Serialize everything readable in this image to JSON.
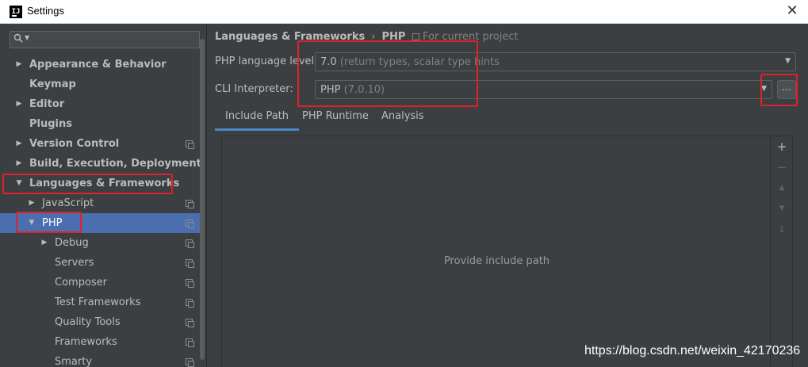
{
  "window": {
    "title": "Settings"
  },
  "sidebar": {
    "search": {
      "value": ""
    },
    "items": [
      {
        "label": "Appearance & Behavior",
        "arrow": "▶",
        "bold": true,
        "level": 0,
        "project": false
      },
      {
        "label": "Keymap",
        "arrow": "",
        "bold": true,
        "level": 0,
        "project": false
      },
      {
        "label": "Editor",
        "arrow": "▶",
        "bold": true,
        "level": 0,
        "project": false
      },
      {
        "label": "Plugins",
        "arrow": "",
        "bold": true,
        "level": 0,
        "project": false
      },
      {
        "label": "Version Control",
        "arrow": "▶",
        "bold": true,
        "level": 0,
        "project": true
      },
      {
        "label": "Build, Execution, Deployment",
        "arrow": "▶",
        "bold": true,
        "level": 0,
        "project": false
      },
      {
        "label": "Languages & Frameworks",
        "arrow": "▼",
        "bold": true,
        "level": 0,
        "project": false
      },
      {
        "label": "JavaScript",
        "arrow": "▶",
        "bold": false,
        "level": 1,
        "project": true
      },
      {
        "label": "PHP",
        "arrow": "▼",
        "bold": false,
        "level": 1,
        "project": true,
        "selected": true
      },
      {
        "label": "Debug",
        "arrow": "▶",
        "bold": false,
        "level": 2,
        "project": true
      },
      {
        "label": "Servers",
        "arrow": "",
        "bold": false,
        "level": 2,
        "project": true
      },
      {
        "label": "Composer",
        "arrow": "",
        "bold": false,
        "level": 2,
        "project": true
      },
      {
        "label": "Test Frameworks",
        "arrow": "",
        "bold": false,
        "level": 2,
        "project": true
      },
      {
        "label": "Quality Tools",
        "arrow": "",
        "bold": false,
        "level": 2,
        "project": true
      },
      {
        "label": "Frameworks",
        "arrow": "",
        "bold": false,
        "level": 2,
        "project": true
      },
      {
        "label": "Smarty",
        "arrow": "",
        "bold": false,
        "level": 2,
        "project": true
      }
    ]
  },
  "main": {
    "breadcrumb": {
      "parent": "Languages & Frameworks",
      "separator": "›",
      "current": "PHP"
    },
    "for_project": "For current project",
    "language_level": {
      "label": "PHP language level:",
      "value": "7.0",
      "hint": "(return types, scalar type hints"
    },
    "cli": {
      "label": "CLI Interpreter:",
      "value": "PHP",
      "hint": "(7.0.10)",
      "browse_label": "..."
    },
    "tabs": [
      {
        "label": "Include Path",
        "active": true
      },
      {
        "label": "PHP Runtime",
        "active": false
      },
      {
        "label": "Analysis",
        "active": false
      }
    ],
    "empty_text": "Provide include path",
    "toolbar": {
      "add": "+",
      "remove": "−",
      "up": "▲",
      "down": "▼",
      "sort": "↓"
    }
  },
  "watermark": "https://blog.csdn.net/weixin_42170236",
  "colors": {
    "selection": "#4b6eaf",
    "annotation": "#e0202a",
    "tab_underline": "#4a88c7"
  }
}
